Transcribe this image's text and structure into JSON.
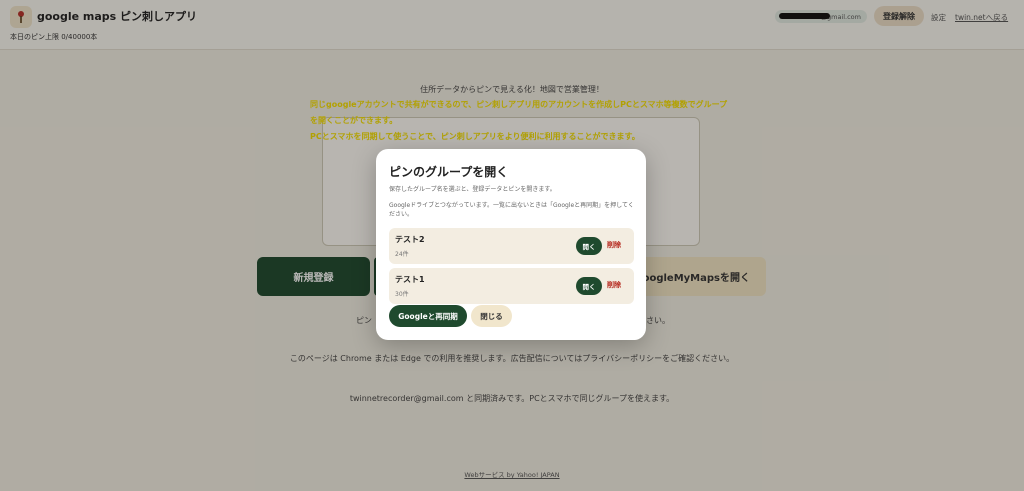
{
  "header": {
    "app_title": "google maps ピン刺しアプリ",
    "pin_limit": "本日のピン上限 0/40000本",
    "account_email_suffix": "@gmail.com",
    "unregister_label": "登録解除",
    "settings_label": "設定",
    "home_link_label": "twin.netへ戻る",
    "app_icon": "pin-icon"
  },
  "page": {
    "tagline": "住所データからピンで見える化！地図で営業管理！",
    "yellow_note": [
      "同じgoogleアカウントで共有ができるので、ピン刺しアプリ用のアカウントを作成しPCとスマホ等複数でグループ",
      "を開くことができます。",
      "PCとスマホを同期して使うことで、ピン刺しアプリをより便利に利用することができます。"
    ],
    "new_register_label": "新規登録",
    "mymaps_label": "GoogleMyMapsを開く",
    "pin_note_start": "ピン",
    "pin_note_end": "さい。",
    "browser_note": "このページは Chrome または Edge での利用を推奨します。広告配信についてはプライバシーポリシーをご確認ください。",
    "sync_note": "twinnetrecorder@gmail.com と同期済みです。PCとスマホで同じグループを使えます。",
    "footer_credit": "Webサービス by Yahoo! JAPAN"
  },
  "modal": {
    "title": "ピンのグループを開く",
    "description": "保存したグループ名を選ぶと、登録データとピンを開きます。",
    "description2": "Googleドライブとつながっています。一覧に出ないときは「Googleと再同期」を押してください。",
    "groups": [
      {
        "name": "テスト2",
        "count": "24件",
        "open_label": "開く",
        "delete_label": "削除"
      },
      {
        "name": "テスト1",
        "count": "30件",
        "open_label": "開く",
        "delete_label": "削除"
      }
    ],
    "resync_label": "Googleと再同期",
    "close_label": "閉じる"
  },
  "colors": {
    "primary_green": "#1f4a2e",
    "accent_beige": "#f1e6cc",
    "note_yellow": "#f6e000",
    "delete_red": "#b42318"
  }
}
